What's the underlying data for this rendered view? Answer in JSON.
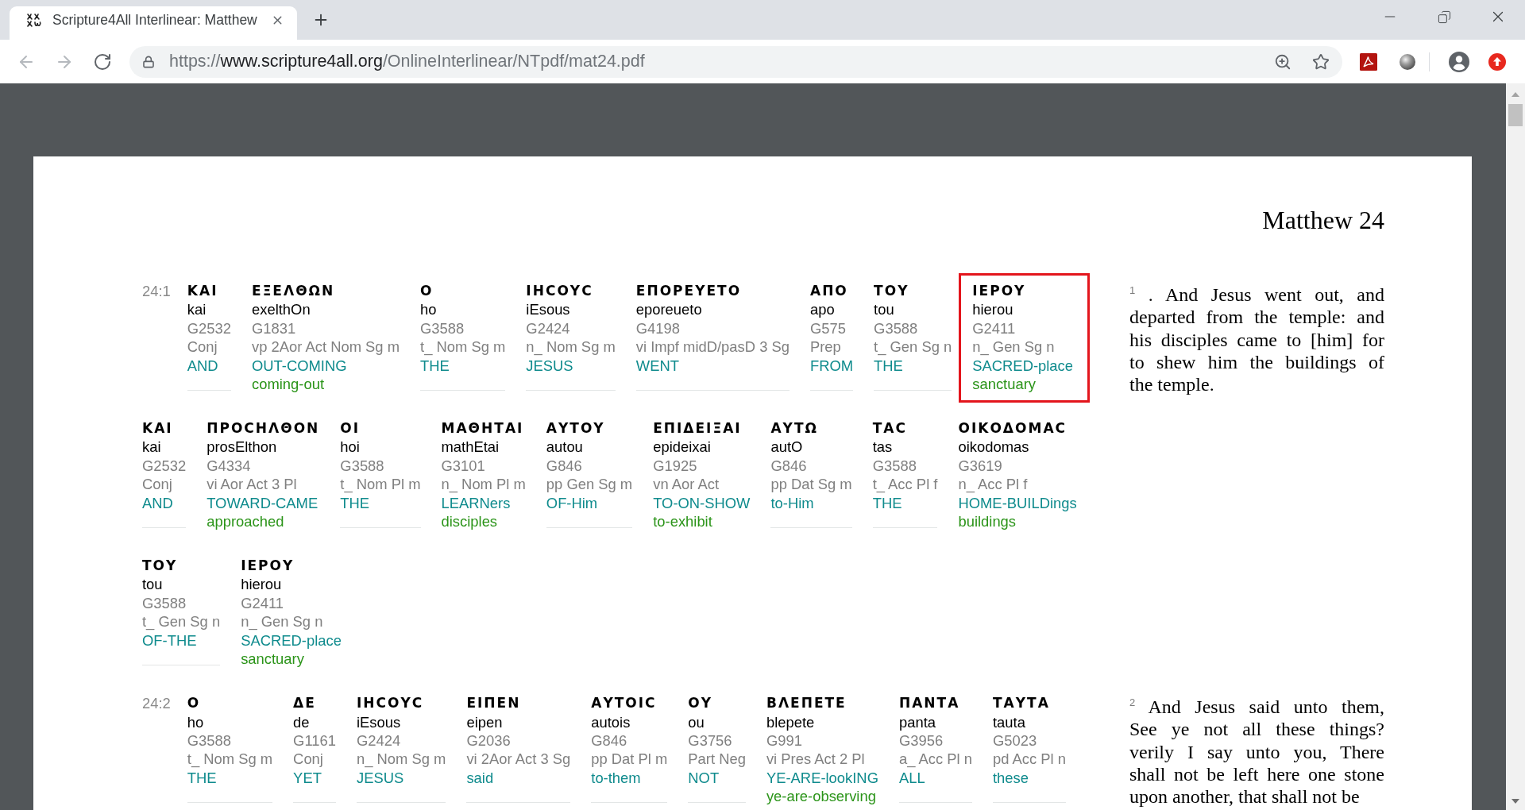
{
  "browser": {
    "tabs": [
      {
        "title": "Scripture4All Interlinear: Matthew",
        "selected": true
      }
    ],
    "nav_buttons": [
      {
        "kind": "back",
        "disabled": true
      },
      {
        "kind": "forward",
        "disabled": true
      },
      {
        "kind": "reload",
        "disabled": false
      }
    ],
    "url": {
      "scheme": "https://",
      "host": "www.scripture4all.org",
      "path": "/OnlineInterlinear/NTpdf/mat24.pdf"
    }
  },
  "document": {
    "title": "Matthew 24",
    "verses": [
      {
        "reference": "24:1",
        "lines": [
          [
            {
              "greek": "ΚΑΙ",
              "translit": "kai",
              "strong": "G2532",
              "parsing": "Conj",
              "gloss": "AND",
              "highlighted": false
            },
            {
              "greek": "ΕΞΕΛΘΩΝ",
              "translit": "exelthOn",
              "strong": "G1831",
              "parsing": "vp 2Aor Act Nom Sg m",
              "gloss": "OUT-COMING",
              "gloss_alt": "coming-out",
              "highlighted": false
            },
            {
              "greek": "Ο",
              "translit": "ho",
              "strong": "G3588",
              "parsing": "t_ Nom Sg m",
              "gloss": "THE",
              "highlighted": false
            },
            {
              "greek": "ΙΗϹΟΥϹ",
              "translit": "iEsous",
              "strong": "G2424",
              "parsing": "n_ Nom Sg m",
              "gloss": "JESUS",
              "highlighted": false
            },
            {
              "greek": "ΕΠΟΡΕΥΕΤΟ",
              "translit": "eporeueto",
              "strong": "G4198",
              "parsing": "vi Impf midD/pasD 3 Sg",
              "gloss": "WENT",
              "highlighted": false
            },
            {
              "greek": "ΑΠΟ",
              "translit": "apo",
              "strong": "G575",
              "parsing": "Prep",
              "gloss": "FROM",
              "highlighted": false
            },
            {
              "greek": "ΤΟΥ",
              "translit": "tou",
              "strong": "G3588",
              "parsing": "t_ Gen Sg n",
              "gloss": "THE",
              "highlighted": false
            },
            {
              "greek": "ΙΕΡΟΥ",
              "translit": "hierou",
              "strong": "G2411",
              "parsing": "n_ Gen Sg n",
              "gloss": "SACRED-place",
              "gloss_alt": "sanctuary",
              "highlighted": true
            }
          ],
          [
            {
              "greek": "ΚΑΙ",
              "translit": "kai",
              "strong": "G2532",
              "parsing": "Conj",
              "gloss": "AND",
              "highlighted": false
            },
            {
              "greek": "ΠΡΟϹΗΛΘΟΝ",
              "translit": "prosElthon",
              "strong": "G4334",
              "parsing": "vi Aor Act 3 Pl",
              "gloss": "TOWARD-CAME",
              "gloss_alt": "approached",
              "highlighted": false
            },
            {
              "greek": "ΟΙ",
              "translit": "hoi",
              "strong": "G3588",
              "parsing": "t_ Nom Pl m",
              "gloss": "THE",
              "highlighted": false
            },
            {
              "greek": "ΜΑΘΗΤΑΙ",
              "translit": "mathEtai",
              "strong": "G3101",
              "parsing": "n_ Nom Pl m",
              "gloss": "LEARNers",
              "gloss_alt": "disciples",
              "highlighted": false
            },
            {
              "greek": "ΑΥΤΟΥ",
              "translit": "autou",
              "strong": "G846",
              "parsing": "pp Gen Sg m",
              "gloss": "OF-Him",
              "highlighted": false
            },
            {
              "greek": "ΕΠΙΔΕΙΞΑΙ",
              "translit": "epideixai",
              "strong": "G1925",
              "parsing": "vn Aor Act",
              "gloss": "TO-ON-SHOW",
              "gloss_alt": "to-exhibit",
              "highlighted": false
            },
            {
              "greek": "ΑΥΤΩ",
              "translit": "autO",
              "strong": "G846",
              "parsing": "pp Dat Sg m",
              "gloss": "to-Him",
              "highlighted": false
            },
            {
              "greek": "ΤΑϹ",
              "translit": "tas",
              "strong": "G3588",
              "parsing": "t_ Acc Pl f",
              "gloss": "THE",
              "highlighted": false
            },
            {
              "greek": "ΟΙΚΟΔΟΜΑϹ",
              "translit": "oikodomas",
              "strong": "G3619",
              "parsing": "n_ Acc Pl f",
              "gloss": "HOME-BUILDings",
              "gloss_alt": "buildings",
              "highlighted": false
            }
          ],
          [
            {
              "greek": "ΤΟΥ",
              "translit": "tou",
              "strong": "G3588",
              "parsing": "t_ Gen Sg n",
              "gloss": "OF-THE",
              "highlighted": false
            },
            {
              "greek": "ΙΕΡΟΥ",
              "translit": "hierou",
              "strong": "G2411",
              "parsing": "n_ Gen Sg n",
              "gloss": "SACRED-place",
              "gloss_alt": "sanctuary",
              "highlighted": false
            }
          ]
        ],
        "text_lines": [
          "$^{1}$ . And Jesus went out, and",
          "departed from the temple: and",
          "his disciples came to [him] for",
          "to shew him the buildings of",
          "the temple."
        ]
      },
      {
        "reference": "24:2",
        "lines": [
          [
            {
              "greek": "Ο",
              "translit": "ho",
              "strong": "G3588",
              "parsing": "t_ Nom Sg m",
              "gloss": "THE",
              "highlighted": false
            },
            {
              "greek": "ΔΕ",
              "translit": "de",
              "strong": "G1161",
              "parsing": "Conj",
              "gloss": "YET",
              "highlighted": false
            },
            {
              "greek": "ΙΗϹΟΥϹ",
              "translit": "iEsous",
              "strong": "G2424",
              "parsing": "n_ Nom Sg m",
              "gloss": "JESUS",
              "highlighted": false
            },
            {
              "greek": "ΕΙΠΕΝ",
              "translit": "eipen",
              "strong": "G2036",
              "parsing": "vi 2Aor Act 3 Sg",
              "gloss": "said",
              "highlighted": false
            },
            {
              "greek": "ΑΥΤΟΙϹ",
              "translit": "autois",
              "strong": "G846",
              "parsing": "pp Dat Pl m",
              "gloss": "to-them",
              "highlighted": false
            },
            {
              "greek": "ΟΥ",
              "translit": "ou",
              "strong": "G3756",
              "parsing": "Part Neg",
              "gloss": "NOT",
              "highlighted": false
            },
            {
              "greek": "ΒΛΕΠΕΤΕ",
              "translit": "blepete",
              "strong": "G991",
              "parsing": "vi Pres Act 2 Pl",
              "gloss": "YE-ARE-lookING",
              "gloss_alt": "ye-are-observing",
              "highlighted": false
            },
            {
              "greek": "ΠΑΝΤΑ",
              "translit": "panta",
              "strong": "G3956",
              "parsing": "a_ Acc Pl n",
              "gloss": "ALL",
              "highlighted": false
            },
            {
              "greek": "ΤΑΥΤΑ",
              "translit": "tauta",
              "strong": "G5023",
              "parsing": "pd Acc Pl n",
              "gloss": "these",
              "highlighted": false
            }
          ]
        ],
        "text_lines": [
          "$^{2}$ And Jesus said unto them,",
          "See ye not all these things?",
          "verily I say unto you, There",
          "shall not be left here one stone",
          "upon another, that shall not be"
        ]
      }
    ]
  }
}
